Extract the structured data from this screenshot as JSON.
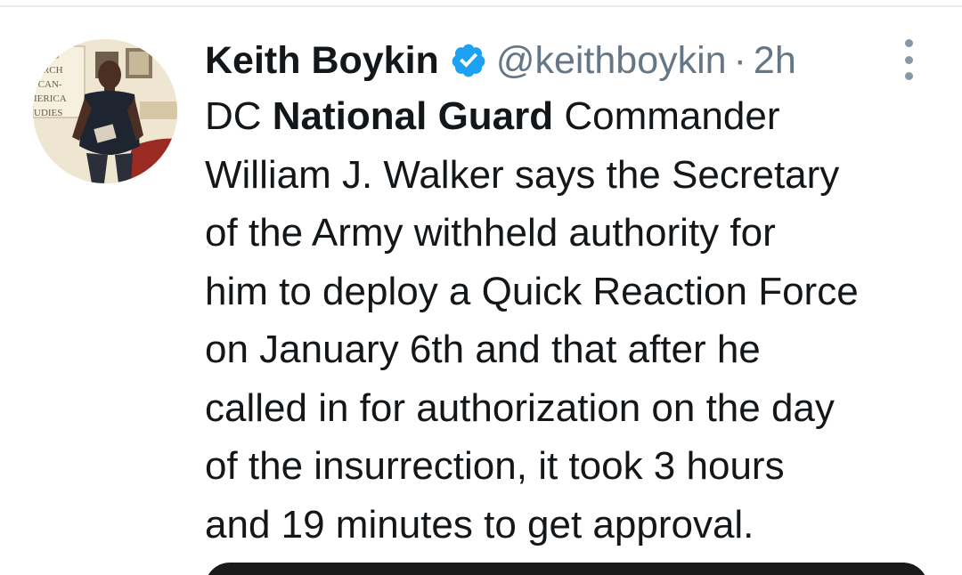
{
  "author": {
    "name": "Keith Boykin",
    "handle": "@keithboykin",
    "separator": "·",
    "timestamp": "2h",
    "verified": true,
    "avatar_sign_text": [
      "E FO",
      "ARCH",
      "ICAN-",
      "IERICA",
      "UDIES"
    ]
  },
  "tweet": {
    "lines": [
      {
        "pre": "DC ",
        "bold": "National Guard",
        "post": " Commander"
      },
      {
        "pre": "William J. Walker says the Secretary"
      },
      {
        "pre": "of the Army withheld authority for"
      },
      {
        "pre": "him to deploy a Quick Reaction Force"
      },
      {
        "pre": "on January 6th and that after he"
      },
      {
        "pre": "called in for authorization on the day"
      },
      {
        "pre": "of the insurrection, it took 3 hours"
      },
      {
        "pre": "and 19 minutes to get approval."
      }
    ]
  },
  "icons": {
    "verified": "verified-badge-icon",
    "more": "more-vertical-icon"
  },
  "colors": {
    "text": "#14171a",
    "secondary": "#657786",
    "verified_blue": "#1da1f2",
    "divider": "#e6ecf0"
  }
}
